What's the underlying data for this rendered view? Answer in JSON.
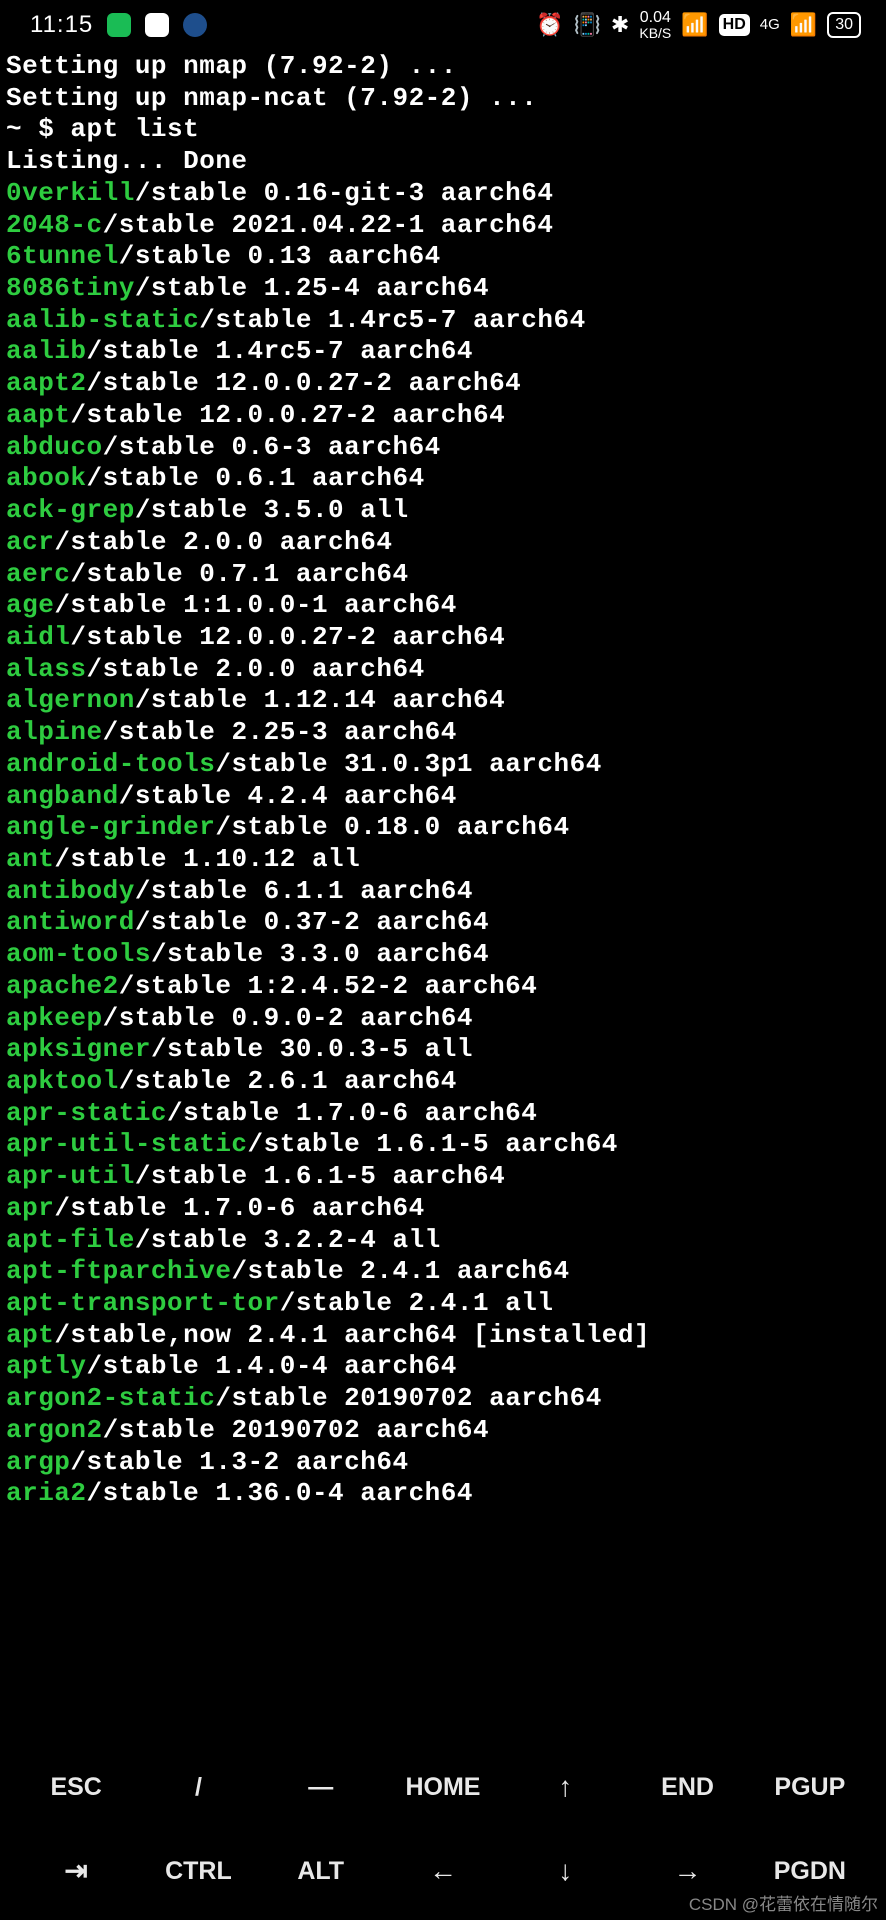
{
  "status": {
    "time": "11:15",
    "kbs_top": "0.04",
    "kbs_label": "KB/S",
    "hd": "HD",
    "network": "4G",
    "battery": "30"
  },
  "terminal": {
    "pre_lines": [
      "Setting up nmap (7.92-2) ...",
      "Setting up nmap-ncat (7.92-2) ...",
      "~ $ apt list",
      "Listing... Done"
    ],
    "packages": [
      {
        "name": "0verkill",
        "rest": "/stable 0.16-git-3 aarch64"
      },
      {
        "name": "2048-c",
        "rest": "/stable 2021.04.22-1 aarch64"
      },
      {
        "name": "6tunnel",
        "rest": "/stable 0.13 aarch64"
      },
      {
        "name": "8086tiny",
        "rest": "/stable 1.25-4 aarch64"
      },
      {
        "name": "aalib-static",
        "rest": "/stable 1.4rc5-7 aarch64"
      },
      {
        "name": "aalib",
        "rest": "/stable 1.4rc5-7 aarch64"
      },
      {
        "name": "aapt2",
        "rest": "/stable 12.0.0.27-2 aarch64"
      },
      {
        "name": "aapt",
        "rest": "/stable 12.0.0.27-2 aarch64"
      },
      {
        "name": "abduco",
        "rest": "/stable 0.6-3 aarch64"
      },
      {
        "name": "abook",
        "rest": "/stable 0.6.1 aarch64"
      },
      {
        "name": "ack-grep",
        "rest": "/stable 3.5.0 all"
      },
      {
        "name": "acr",
        "rest": "/stable 2.0.0 aarch64"
      },
      {
        "name": "aerc",
        "rest": "/stable 0.7.1 aarch64"
      },
      {
        "name": "age",
        "rest": "/stable 1:1.0.0-1 aarch64"
      },
      {
        "name": "aidl",
        "rest": "/stable 12.0.0.27-2 aarch64"
      },
      {
        "name": "alass",
        "rest": "/stable 2.0.0 aarch64"
      },
      {
        "name": "algernon",
        "rest": "/stable 1.12.14 aarch64"
      },
      {
        "name": "alpine",
        "rest": "/stable 2.25-3 aarch64"
      },
      {
        "name": "android-tools",
        "rest": "/stable 31.0.3p1 aarch64"
      },
      {
        "name": "angband",
        "rest": "/stable 4.2.4 aarch64"
      },
      {
        "name": "angle-grinder",
        "rest": "/stable 0.18.0 aarch64"
      },
      {
        "name": "ant",
        "rest": "/stable 1.10.12 all"
      },
      {
        "name": "antibody",
        "rest": "/stable 6.1.1 aarch64"
      },
      {
        "name": "antiword",
        "rest": "/stable 0.37-2 aarch64"
      },
      {
        "name": "aom-tools",
        "rest": "/stable 3.3.0 aarch64"
      },
      {
        "name": "apache2",
        "rest": "/stable 1:2.4.52-2 aarch64"
      },
      {
        "name": "apkeep",
        "rest": "/stable 0.9.0-2 aarch64"
      },
      {
        "name": "apksigner",
        "rest": "/stable 30.0.3-5 all"
      },
      {
        "name": "apktool",
        "rest": "/stable 2.6.1 aarch64"
      },
      {
        "name": "apr-static",
        "rest": "/stable 1.7.0-6 aarch64"
      },
      {
        "name": "apr-util-static",
        "rest": "/stable 1.6.1-5 aarch64"
      },
      {
        "name": "apr-util",
        "rest": "/stable 1.6.1-5 aarch64"
      },
      {
        "name": "apr",
        "rest": "/stable 1.7.0-6 aarch64"
      },
      {
        "name": "apt-file",
        "rest": "/stable 3.2.2-4 all"
      },
      {
        "name": "apt-ftparchive",
        "rest": "/stable 2.4.1 aarch64"
      },
      {
        "name": "apt-transport-tor",
        "rest": "/stable 2.4.1 all"
      },
      {
        "name": "apt",
        "rest": "/stable,now 2.4.1 aarch64 [installed]"
      },
      {
        "name": "aptly",
        "rest": "/stable 1.4.0-4 aarch64"
      },
      {
        "name": "argon2-static",
        "rest": "/stable 20190702 aarch64"
      },
      {
        "name": "argon2",
        "rest": "/stable 20190702 aarch64"
      },
      {
        "name": "argp",
        "rest": "/stable 1.3-2 aarch64"
      },
      {
        "name": "aria2",
        "rest": "/stable 1.36.0-4 aarch64"
      }
    ]
  },
  "keyboard": {
    "row1": [
      "ESC",
      "/",
      "—",
      "HOME",
      "↑",
      "END",
      "PGUP"
    ],
    "row2": [
      "⇥",
      "CTRL",
      "ALT",
      "←",
      "↓",
      "→",
      "PGDN"
    ]
  },
  "watermark": "CSDN @花蕾依在情随尔"
}
